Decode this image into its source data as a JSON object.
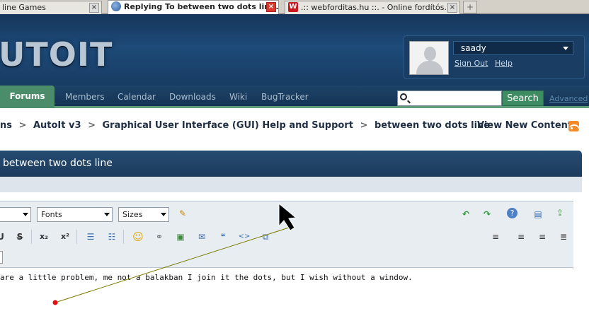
{
  "browser": {
    "tabs": [
      {
        "label": "line Games",
        "active": false
      },
      {
        "label": "Replying To between two dots lin...",
        "active": true
      },
      {
        "label": ".:: webforditas.hu ::. - Online fordítós...",
        "active": false
      }
    ]
  },
  "site": {
    "logo": "UTOIT",
    "user": {
      "name": "saady",
      "sign_out": "Sign Out",
      "help": "Help"
    },
    "nav": [
      {
        "label": "Forums",
        "active": true
      },
      {
        "label": "Members"
      },
      {
        "label": "Calendar"
      },
      {
        "label": "Downloads"
      },
      {
        "label": "Wiki"
      },
      {
        "label": "BugTracker"
      }
    ],
    "search": {
      "placeholder": "",
      "button": "Search",
      "advanced": "Advanced"
    },
    "breadcrumb": [
      "ns",
      "AutoIt v3",
      "Graphical User Interface (GUI) Help and Support",
      "between two dots line"
    ],
    "breadcrumb_sep": ">",
    "view_new": "View New Content",
    "thread_title": "between two dots line"
  },
  "editor": {
    "font_select": "Fonts",
    "size_select": "Sizes",
    "content": "are a little problem, me not a balakban I join it the dots, but I wish without a window."
  },
  "colors": {
    "header": "#1d4a78",
    "nav_active": "#4b8d6a",
    "search_button": "#3e8c61",
    "annotation_line": "#7a7a00",
    "annotation_dot": "#e01010"
  }
}
